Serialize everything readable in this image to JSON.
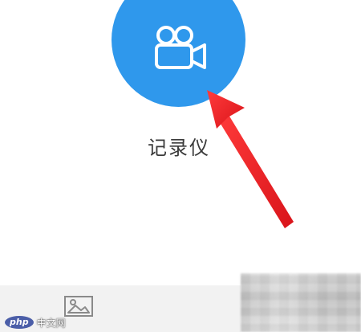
{
  "recorder": {
    "label": "记录仪",
    "icon": "video-camera-icon",
    "button_color": "#2f98ec"
  },
  "annotation": {
    "type": "arrow",
    "color": "#e8262a"
  },
  "bottom_bar": {
    "gallery_icon": "image-gallery-icon",
    "background": "#f2f2f2"
  },
  "watermark": {
    "brand": "php",
    "text": "中文网"
  }
}
